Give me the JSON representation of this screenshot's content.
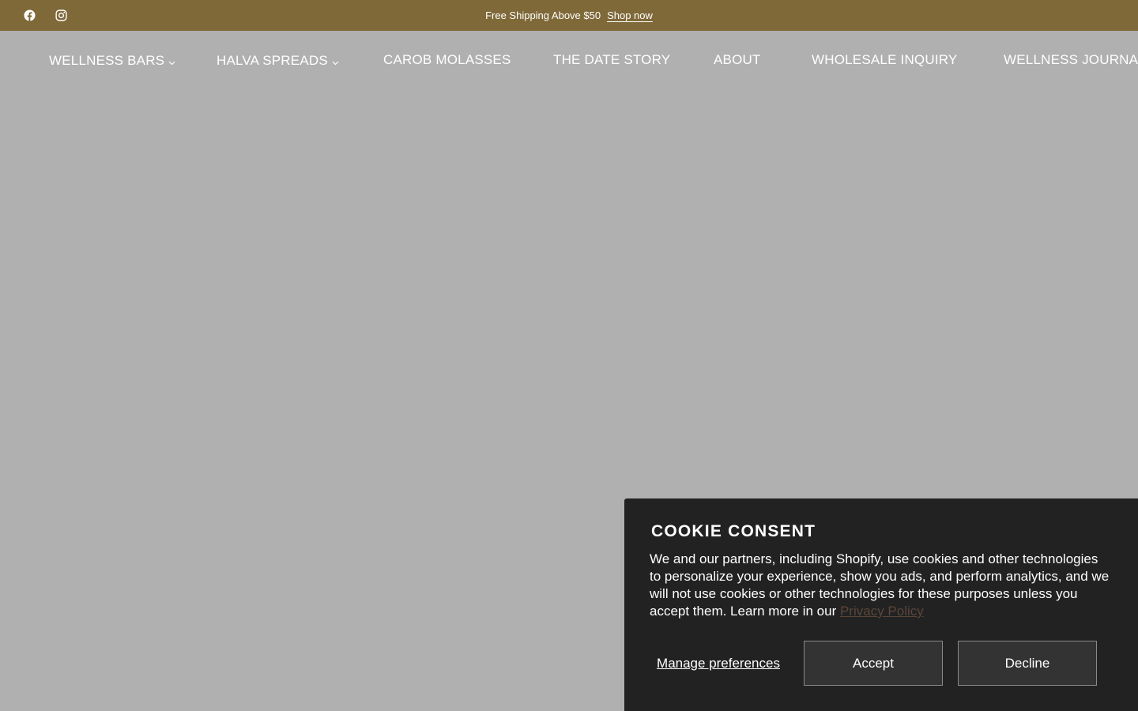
{
  "announcement": {
    "text": "Free Shipping Above $50",
    "link_label": "Shop now",
    "icons": [
      "facebook-icon",
      "instagram-icon"
    ]
  },
  "nav": {
    "items": [
      {
        "label": "WELLNESS BARS",
        "has_dropdown": true
      },
      {
        "label": "HALVA SPREADS",
        "has_dropdown": true
      },
      {
        "label": "CAROB MOLASSES",
        "has_dropdown": false
      },
      {
        "label": "THE DATE STORY",
        "has_dropdown": false
      },
      {
        "label": "ABOUT",
        "has_dropdown": false
      },
      {
        "label": "WHOLESALE INQUIRY",
        "has_dropdown": false
      },
      {
        "label": "WELLNESS JOURNAL",
        "has_dropdown": false
      }
    ]
  },
  "cookie": {
    "title": "Cookie consent",
    "body": "We and our partners, including Shopify, use cookies and other technologies to personalize your experience, show you ads, and perform analytics, and we will not use cookies or other technologies for these purposes unless you accept them. Learn more in our ",
    "privacy_label": "Privacy Policy",
    "manage_label": "Manage preferences",
    "accept_label": "Accept",
    "decline_label": "Decline"
  },
  "colors": {
    "announcement_bg": "#7f6939",
    "page_bg": "#b0b0b0",
    "banner_bg": "#222222",
    "button_bg": "#333333",
    "privacy_link": "#5a463a"
  }
}
